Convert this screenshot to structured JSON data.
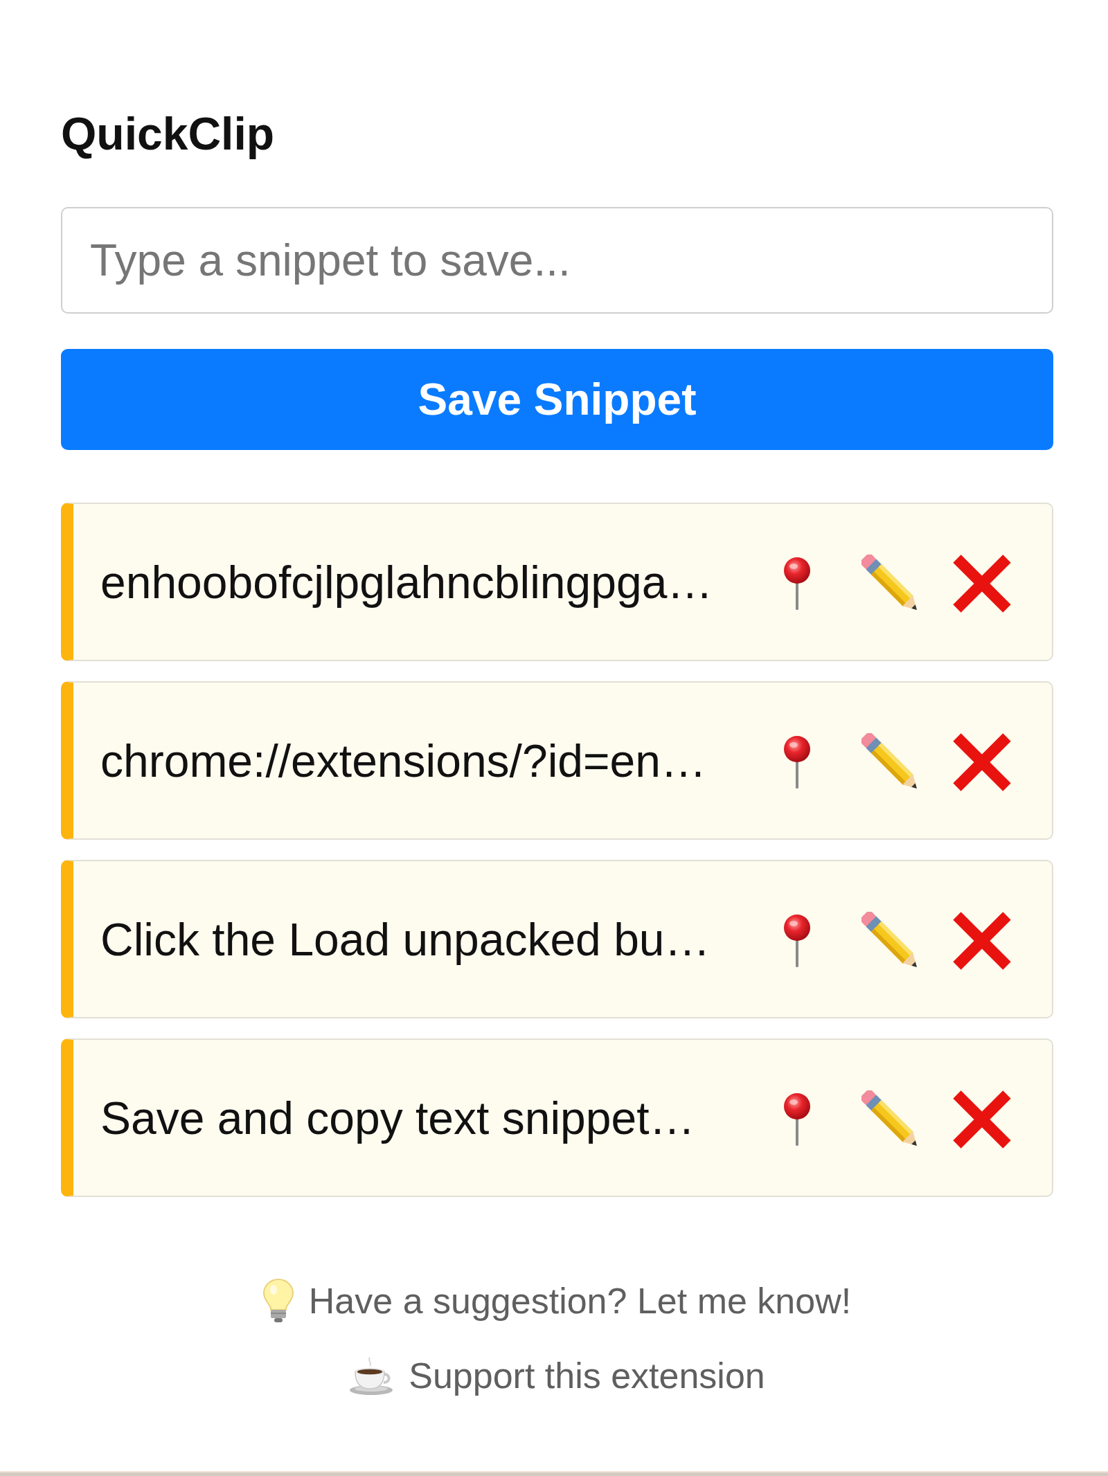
{
  "app": {
    "title": "QuickClip"
  },
  "snippet_input": {
    "placeholder": "Type a snippet to save..."
  },
  "save_button": {
    "label": "Save Snippet"
  },
  "snippets": [
    {
      "text": "enhoobofcjlpglahncblingpga…"
    },
    {
      "text": "chrome://extensions/?id=en…"
    },
    {
      "text": "Click the Load unpacked bu…"
    },
    {
      "text": "Save and copy text snippet…"
    }
  ],
  "footer": {
    "links": [
      {
        "kind": "suggestion",
        "label": "Have a suggestion? Let me know!"
      },
      {
        "kind": "support",
        "label": "Support this extension"
      }
    ]
  }
}
